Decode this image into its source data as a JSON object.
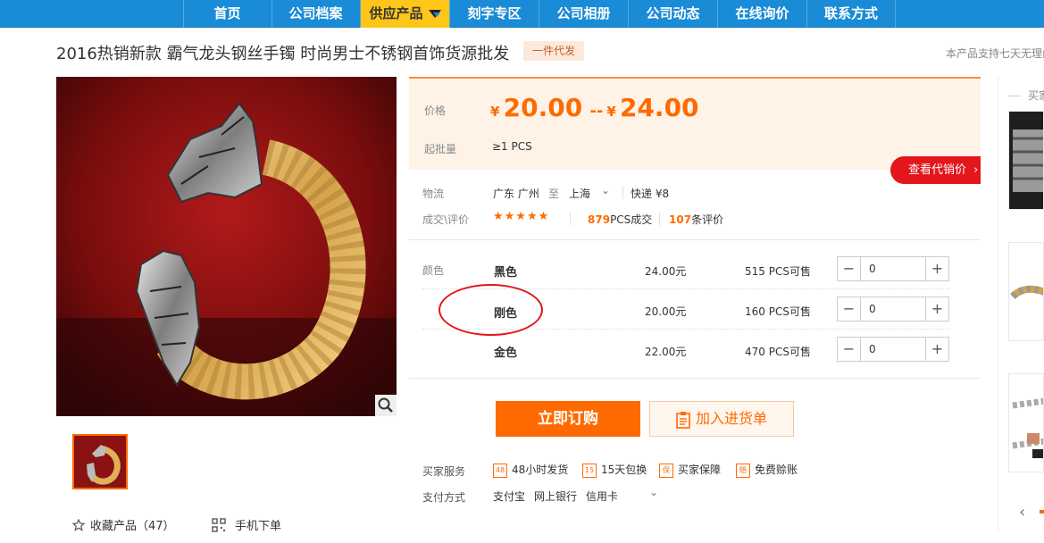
{
  "nav": {
    "items": [
      "首页",
      "公司档案",
      "供应产品",
      "刻字专区",
      "公司相册",
      "公司动态",
      "在线询价",
      "联系方式"
    ],
    "active_index": 2
  },
  "product": {
    "title": "2016热销新款 霸气龙头钢丝手镯 时尚男士不锈钢首饰货源批发",
    "badge": "一件代发",
    "promise": "本产品支持七天无理由"
  },
  "pricing": {
    "price_label": "价格",
    "currency": "¥",
    "price_min": "20.00",
    "price_sep": "--",
    "price_max": "24.00",
    "moq_label": "起批量",
    "moq_value": "≥1  PCS",
    "agent_price_button": "查看代销价"
  },
  "logistics": {
    "label": "物流",
    "from": "广东 广州",
    "to_word": "至",
    "to": "上海",
    "shipping": "快递 ¥8"
  },
  "reviews": {
    "label": "成交\\评价",
    "stars": "★★★★★",
    "deals_count": "879",
    "deals_suffix": "PCS成交",
    "reviews_count": "107",
    "reviews_suffix": "条评价"
  },
  "variants": {
    "label": "颜色",
    "rows": [
      {
        "name": "黑色",
        "price": "24.00元",
        "stock": "515 PCS可售",
        "qty": "0"
      },
      {
        "name": "刚色",
        "price": "20.00元",
        "stock": "160 PCS可售",
        "qty": "0"
      },
      {
        "name": "金色",
        "price": "22.00元",
        "stock": "470 PCS可售",
        "qty": "0"
      }
    ],
    "minus": "−",
    "plus": "+"
  },
  "actions": {
    "buy_now": "立即订购",
    "add_to_cart": "加入进货单"
  },
  "services": {
    "label": "买家服务",
    "items": [
      {
        "icon": "48",
        "text": "48小时发货"
      },
      {
        "icon": "15",
        "text": "15天包换"
      },
      {
        "icon": "保",
        "text": "买家保障"
      },
      {
        "icon": "赔",
        "text": "免费赊账"
      }
    ]
  },
  "payment": {
    "label": "支付方式",
    "methods": [
      "支付宝",
      "网上银行",
      "信用卡"
    ]
  },
  "gallery": {
    "favorite": "收藏产品（47）",
    "mobile_order": "手机下单"
  },
  "sidebar": {
    "label": "买家"
  },
  "colors": {
    "nav_blue": "#1a8bd6",
    "nav_active": "#ffc61a",
    "accent_orange": "#ff6a00",
    "agent_red": "#e2161b"
  }
}
